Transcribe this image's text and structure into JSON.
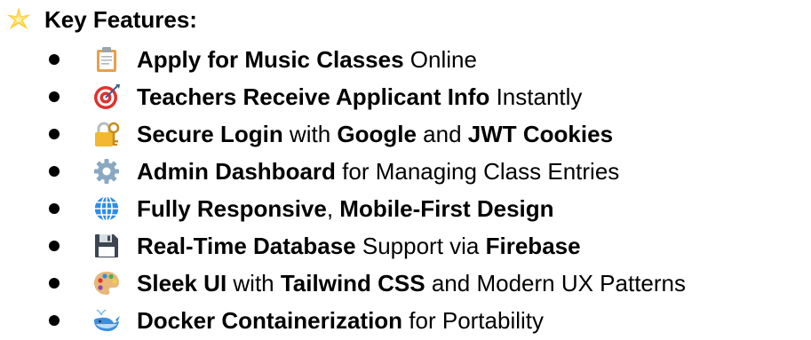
{
  "heading": {
    "icon": "glowing-star-icon",
    "text": "Key Features:"
  },
  "features": [
    {
      "icon": "clipboard-icon",
      "segments": [
        {
          "text": "Apply for Music Classes",
          "bold": true
        },
        {
          "text": " Online",
          "bold": false
        }
      ]
    },
    {
      "icon": "direct-hit-target-icon",
      "segments": [
        {
          "text": "Teachers Receive Applicant Info",
          "bold": true
        },
        {
          "text": " Instantly",
          "bold": false
        }
      ]
    },
    {
      "icon": "locked-with-key-icon",
      "segments": [
        {
          "text": "Secure Login",
          "bold": true
        },
        {
          "text": " with ",
          "bold": false
        },
        {
          "text": "Google",
          "bold": true
        },
        {
          "text": " and ",
          "bold": false
        },
        {
          "text": "JWT Cookies",
          "bold": true
        }
      ]
    },
    {
      "icon": "gear-icon",
      "segments": [
        {
          "text": "Admin Dashboard",
          "bold": true
        },
        {
          "text": " for Managing Class Entries",
          "bold": false
        }
      ]
    },
    {
      "icon": "globe-with-meridians-icon",
      "segments": [
        {
          "text": "Fully Responsive",
          "bold": true
        },
        {
          "text": ", ",
          "bold": false
        },
        {
          "text": "Mobile-First Design",
          "bold": true
        }
      ]
    },
    {
      "icon": "floppy-disk-icon",
      "segments": [
        {
          "text": "Real-Time Database",
          "bold": true
        },
        {
          "text": " Support via ",
          "bold": false
        },
        {
          "text": "Firebase",
          "bold": true
        }
      ]
    },
    {
      "icon": "artist-palette-icon",
      "segments": [
        {
          "text": "Sleek UI",
          "bold": true
        },
        {
          "text": " with ",
          "bold": false
        },
        {
          "text": "Tailwind CSS",
          "bold": true
        },
        {
          "text": " and Modern UX Patterns",
          "bold": false
        }
      ]
    },
    {
      "icon": "whale-icon",
      "segments": [
        {
          "text": "Docker Containerization",
          "bold": true
        },
        {
          "text": " for Portability",
          "bold": false
        }
      ]
    }
  ]
}
